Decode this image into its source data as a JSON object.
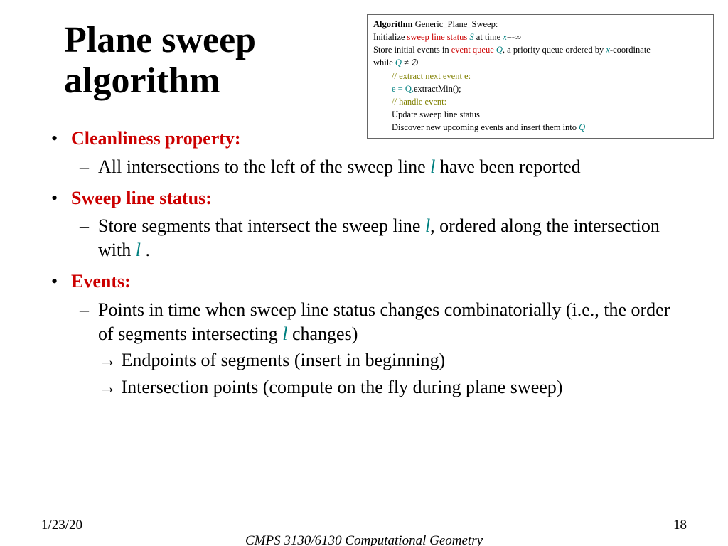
{
  "title_line1": "Plane sweep",
  "title_line2": "algorithm",
  "algo": {
    "header_prefix": "Algorithm",
    "header_name": " Generic_Plane_Sweep:",
    "l1_a": "Initialize ",
    "l1_b_red": "sweep line status",
    "l1_c": " ",
    "l1_S": "S",
    "l1_d": " at time ",
    "l1_x": "x",
    "l1_e": "=-∞",
    "l2_a": "Store initial events in ",
    "l2_b_red": "event queue",
    "l2_c": " ",
    "l2_Q": "Q",
    "l2_d": ", a priority queue ordered by ",
    "l2_x": "x",
    "l2_e": "-coordinate",
    "l3_a": "while ",
    "l3_Q": "Q",
    "l3_b": " ≠ ∅",
    "l4_cmt1": "// extract next event e:",
    "l5_a": "e = Q.",
    "l5_b": "extractMin();",
    "l6_cmt2": "// handle event:",
    "l7": "Update sweep line status",
    "l8_a": "Discover new upcoming events and insert them into ",
    "l8_Q": "Q"
  },
  "bullets": {
    "b1_head": "Cleanliness property:",
    "b1_s1_a": "All intersections to the left of the sweep line ",
    "b1_s1_l": "l",
    "b1_s1_b": " have been reported",
    "b2_head": "Sweep line status:",
    "b2_s1_a": "Store segments that intersect the sweep line ",
    "b2_s1_l1": "l",
    "b2_s1_b": ", ordered along the intersection with ",
    "b2_s1_l2": "l",
    "b2_s1_c": " .",
    "b3_head": "Events:",
    "b3_s1_a": "Points in time when sweep line status changes combinatorially (i.e., the order of segments intersecting ",
    "b3_s1_l": "l",
    "b3_s1_b": " changes)",
    "b3_s2": "→ Endpoints of segments (insert in beginning)",
    "b3_s3": "→ Intersection points (compute on the fly during plane sweep)"
  },
  "footer": {
    "date": "1/23/20",
    "course": "CMPS 3130/6130 Computational Geometry",
    "page": "18"
  }
}
